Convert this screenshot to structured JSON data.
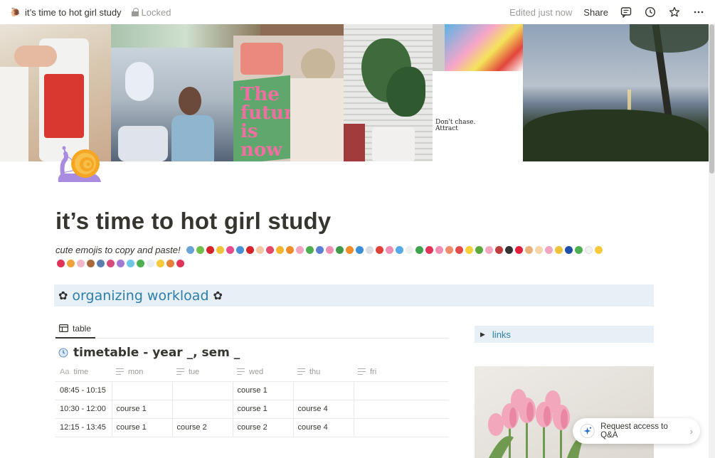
{
  "topbar": {
    "page_emoji": "🐌",
    "page_title": "it’s time to hot girl study",
    "locked_label": "Locked",
    "edited_label": "Edited just now",
    "share_label": "Share",
    "icons": [
      "comment-icon",
      "history-icon",
      "star-icon",
      "more-icon"
    ]
  },
  "cover": {
    "texts": {
      "book_page": "The future is now",
      "quote_line1": "Don't chase.",
      "quote_line2": "Attract"
    }
  },
  "page": {
    "icon": "snail-icon",
    "title": "it’s time to hot girl study",
    "subtitle": "cute emojis to copy and paste!"
  },
  "callout": {
    "text": "organizing workload",
    "left_icon": "flower-icon",
    "right_icon": "flower-icon"
  },
  "view": {
    "tab_label": "table",
    "db_title": "timetable - year _, sem _"
  },
  "table": {
    "columns": [
      {
        "label": "time",
        "icon": "Aa"
      },
      {
        "label": "mon",
        "icon": "text-lines"
      },
      {
        "label": "tue",
        "icon": "text-lines"
      },
      {
        "label": "wed",
        "icon": "text-lines"
      },
      {
        "label": "thu",
        "icon": "text-lines"
      },
      {
        "label": "fri",
        "icon": "text-lines"
      }
    ],
    "rows": [
      [
        "08:45 - 10:15",
        "",
        "",
        "course 1",
        "",
        ""
      ],
      [
        "10:30 - 12:00",
        "course 1",
        "",
        "course 1",
        "course 4",
        ""
      ],
      [
        "12:15 - 13:45",
        "course 1",
        "course 2",
        "course 2",
        "course 4",
        ""
      ]
    ]
  },
  "sidebar": {
    "toggle_label": "links"
  },
  "qa": {
    "label": "Request access to Q&A"
  },
  "colors": {
    "accent_blue": "#2e7eaa",
    "callout_bg": "#e7f0f6",
    "muted": "#9b9a97",
    "text": "#37352f"
  }
}
